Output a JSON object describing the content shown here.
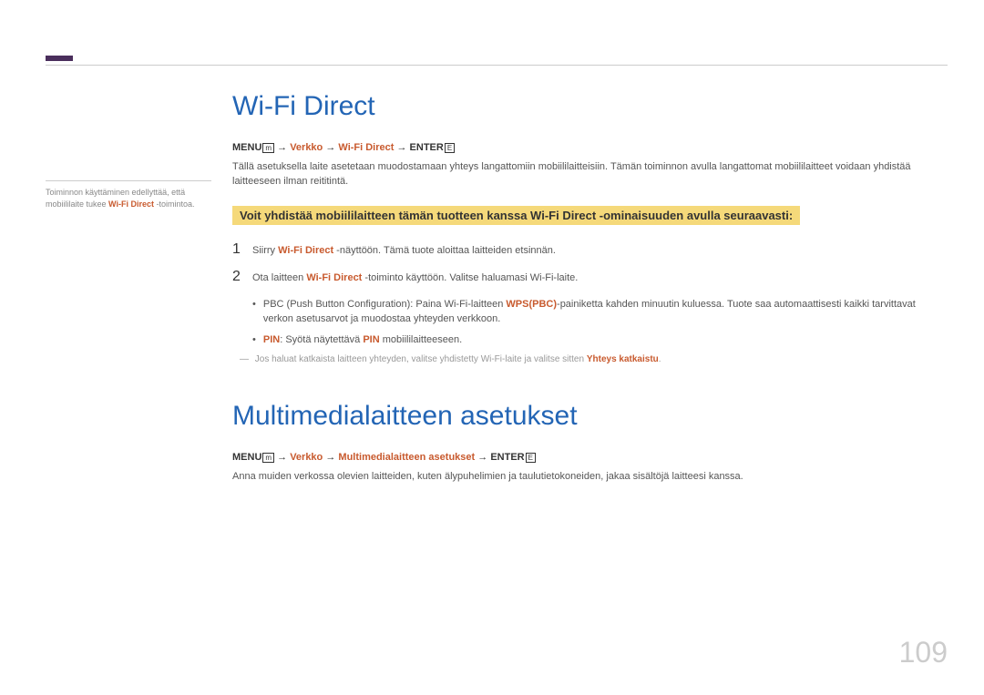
{
  "sideNote": {
    "prefix": "Toiminnon käyttäminen edellyttää, että mobiililaite tukee ",
    "highlight": "Wi-Fi Direct",
    "suffix": " -toimintoa."
  },
  "section1": {
    "heading": "Wi-Fi Direct",
    "menu": {
      "m": "MENU",
      "arrow": " → ",
      "p1": "Verkko",
      "p2": "Wi-Fi Direct",
      "enter": "ENTER"
    },
    "intro": "Tällä asetuksella laite asetetaan muodostamaan yhteys langattomiin mobiililaitteisiin. Tämän toiminnon avulla langattomat mobiililaitteet voidaan yhdistää laitteeseen ilman reititintä.",
    "highlight": "Voit yhdistää mobiililaitteen tämän tuotteen kanssa Wi-Fi Direct -ominaisuuden avulla seuraavasti:",
    "steps": [
      {
        "n": "1",
        "pre": "Siirry ",
        "b": "Wi-Fi Direct",
        "post": " -näyttöön. Tämä tuote aloittaa laitteiden etsinnän."
      },
      {
        "n": "2",
        "pre": "Ota laitteen ",
        "b": "Wi-Fi Direct",
        "post": " -toiminto käyttöön. Valitse haluamasi Wi-Fi-laite."
      }
    ],
    "bullets": {
      "b1pre": "PBC (Push Button Configuration): Paina Wi-Fi-laitteen ",
      "b1bold": "WPS(PBC)",
      "b1post": "-painiketta kahden minuutin kuluessa. Tuote saa automaattisesti kaikki tarvittavat verkon asetusarvot ja muodostaa yhteyden verkkoon.",
      "b2a": "PIN",
      "b2mid": ": Syötä näytettävä ",
      "b2b": "PIN",
      "b2post": " mobiililaitteeseen."
    },
    "note": {
      "pre": "Jos haluat katkaista laitteen yhteyden, valitse yhdistetty Wi-Fi-laite ja valitse sitten ",
      "b": "Yhteys katkaistu",
      "post": "."
    }
  },
  "section2": {
    "heading": "Multimedialaitteen asetukset",
    "menu": {
      "m": "MENU",
      "arrow": " → ",
      "p1": "Verkko",
      "p2": "Multimedialaitteen asetukset",
      "enter": "ENTER"
    },
    "intro": "Anna muiden verkossa olevien laitteiden, kuten älypuhelimien ja taulutietokoneiden, jakaa sisältöjä laitteesi kanssa."
  },
  "pageNumber": "109"
}
